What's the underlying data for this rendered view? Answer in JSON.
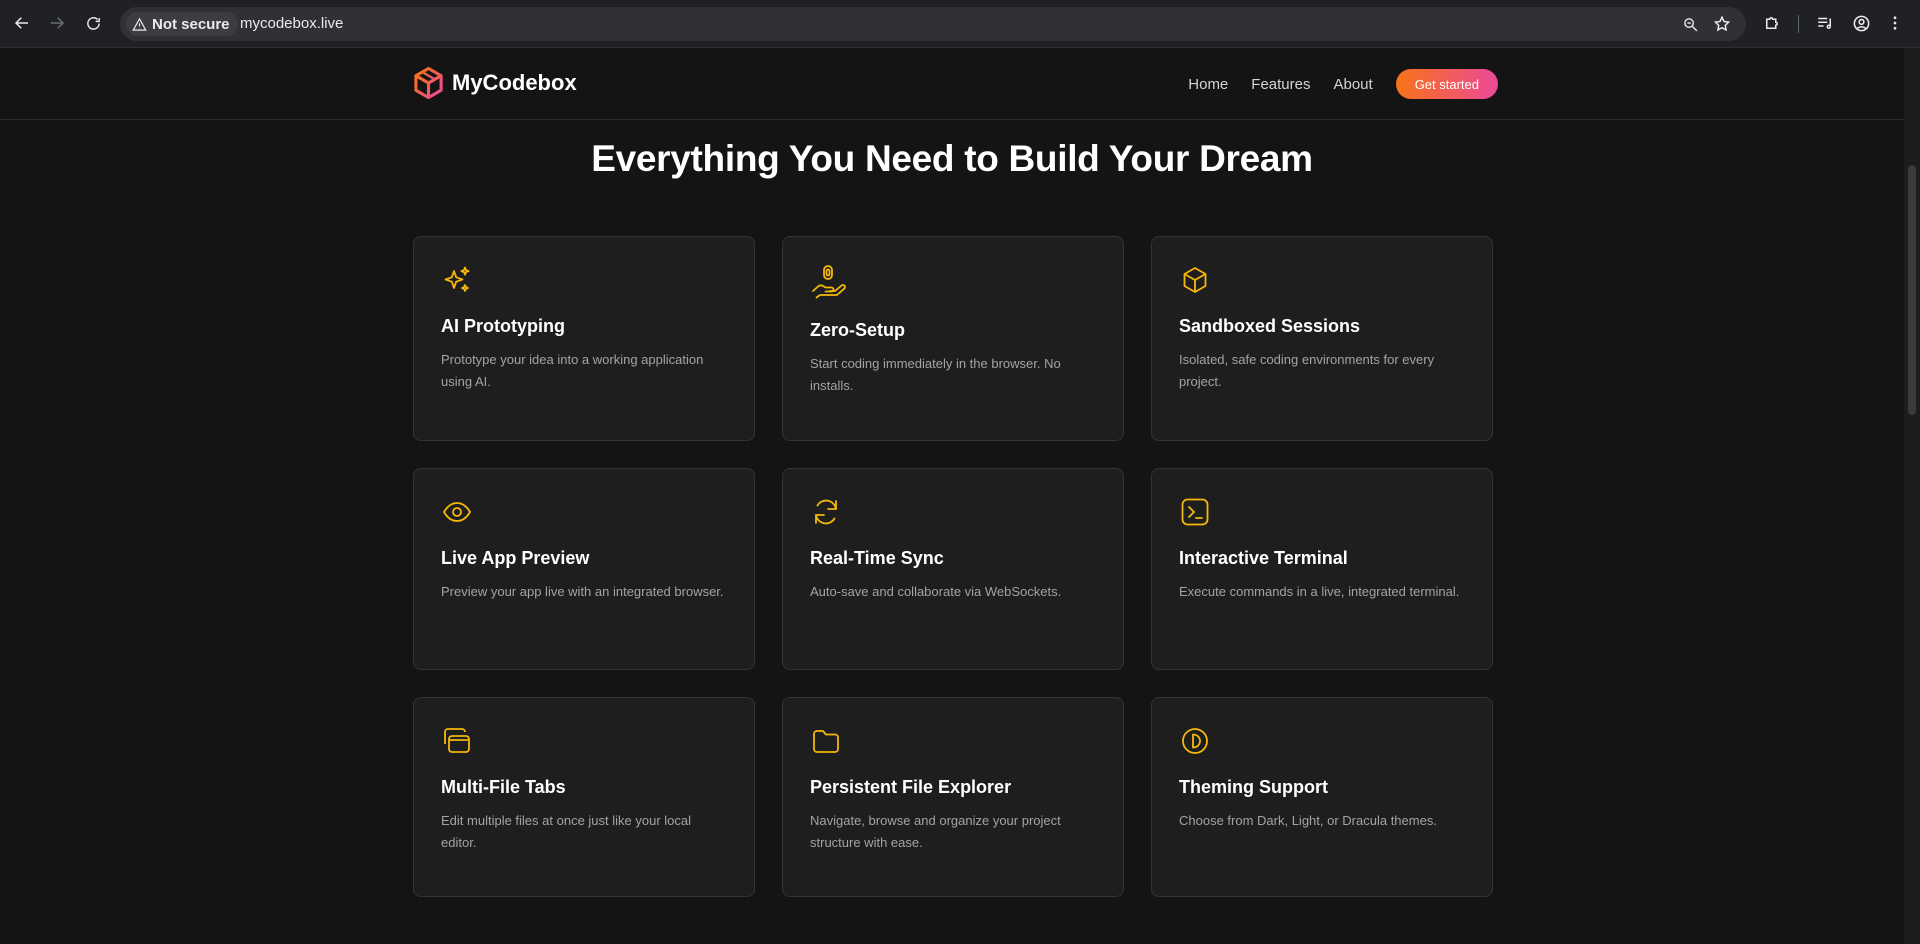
{
  "browser": {
    "security_label": "Not secure",
    "url": "mycodebox.live"
  },
  "site": {
    "brand": "MyCodebox",
    "nav": {
      "home": "Home",
      "features": "Features",
      "about": "About",
      "cta": "Get started"
    }
  },
  "features": {
    "title": "Everything You Need to Build Your Dream",
    "accent": "#f5b80b",
    "cards": [
      {
        "icon": "sparkles-icon",
        "title": "AI Prototyping",
        "desc": "Prototype your idea into a working application using AI."
      },
      {
        "icon": "hand-icon",
        "title": "Zero-Setup",
        "desc": "Start coding immediately in the browser. No installs."
      },
      {
        "icon": "box-icon",
        "title": "Sandboxed Sessions",
        "desc": "Isolated, safe coding environments for every project."
      },
      {
        "icon": "eye-icon",
        "title": "Live App Preview",
        "desc": "Preview your app live with an integrated browser."
      },
      {
        "icon": "sync-icon",
        "title": "Real-Time Sync",
        "desc": "Auto-save and collaborate via WebSockets."
      },
      {
        "icon": "terminal-icon",
        "title": "Interactive Terminal",
        "desc": "Execute commands in a live, integrated terminal."
      },
      {
        "icon": "tabs-icon",
        "title": "Multi-File Tabs",
        "desc": "Edit multiple files at once just like your local editor."
      },
      {
        "icon": "folder-icon",
        "title": "Persistent File Explorer",
        "desc": "Navigate, browse and organize your project structure with ease."
      },
      {
        "icon": "theme-icon",
        "title": "Theming Support",
        "desc": "Choose from Dark, Light, or Dracula themes."
      }
    ]
  }
}
